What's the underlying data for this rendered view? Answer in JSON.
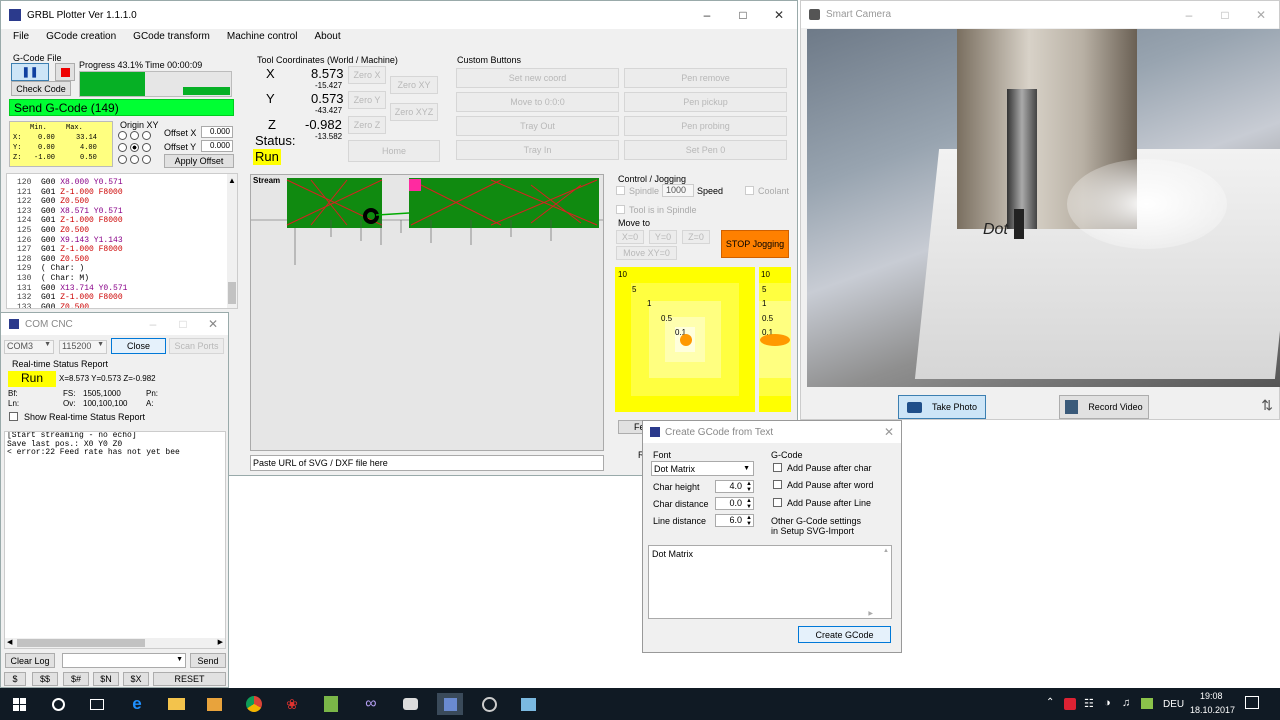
{
  "main_window": {
    "title": "GRBL Plotter Ver 1.1.1.0",
    "menu": [
      "File",
      "GCode creation",
      "GCode transform",
      "Machine control",
      "About"
    ],
    "gcode_file_label": "G-Code File",
    "progress_label": "Progress 43.1%",
    "time_label": "Time 00:00:09",
    "check_code": "Check Code",
    "send_gcode": "Send G-Code (149)",
    "minmax": {
      "min": "Min.",
      "max": "Max.",
      "x": "X:",
      "y": "Y:",
      "z": "Z:",
      "xmin": "0.00",
      "xmax": "33.14",
      "ymin": "0.00",
      "ymax": "4.00",
      "zmin": "-1.00",
      "zmax": "0.50"
    },
    "origin_label": "Origin XY",
    "offset_x_label": "Offset X",
    "offset_y_label": "Offset Y",
    "offset_x": "0.000",
    "offset_y": "0.000",
    "apply_offset": "Apply Offset",
    "tool_coords_label": "Tool Coordinates (World / Machine)",
    "coords": [
      {
        "axis": "X",
        "world": "8.573",
        "machine": "-15.427",
        "zero": "Zero X"
      },
      {
        "axis": "Y",
        "world": "0.573",
        "machine": "-43.427",
        "zero": "Zero Y"
      },
      {
        "axis": "Z",
        "world": "-0.982",
        "machine": "-13.582",
        "zero": "Zero Z"
      }
    ],
    "zero_xy": "Zero XY",
    "zero_xyz": "Zero XYZ",
    "home": "Home",
    "status_label": "Status:",
    "status_value": "Run",
    "custom_buttons_label": "Custom Buttons",
    "custom_buttons": [
      "Set new coord",
      "Pen remove",
      "Move to 0:0:0",
      "Pen pickup",
      "Tray Out",
      "Pen probing",
      "Tray In",
      "Set Pen 0"
    ],
    "gcode_lines": [
      {
        "n": "120",
        "parts": [
          [
            "a",
            "G00 "
          ],
          [
            "b",
            "X8.000 Y0.571"
          ]
        ]
      },
      {
        "n": "121",
        "parts": [
          [
            "a",
            "G01 "
          ],
          [
            "c",
            "Z-1.000 F8000"
          ]
        ]
      },
      {
        "n": "122",
        "parts": [
          [
            "a",
            "G00 "
          ],
          [
            "c",
            "Z0.500"
          ]
        ]
      },
      {
        "n": "123",
        "parts": [
          [
            "a",
            "G00 "
          ],
          [
            "b",
            "X8.571 Y0.571"
          ]
        ]
      },
      {
        "n": "124",
        "parts": [
          [
            "a",
            "G01 "
          ],
          [
            "c",
            "Z-1.000 F8000"
          ]
        ]
      },
      {
        "n": "125",
        "parts": [
          [
            "a",
            "G00 "
          ],
          [
            "c",
            "Z0.500"
          ]
        ]
      },
      {
        "n": "126",
        "parts": [
          [
            "a",
            "G00 "
          ],
          [
            "b",
            "X9.143 Y1.143"
          ]
        ]
      },
      {
        "n": "127",
        "parts": [
          [
            "a",
            "G01 "
          ],
          [
            "c",
            "Z-1.000 F8000"
          ]
        ]
      },
      {
        "n": "128",
        "parts": [
          [
            "a",
            "G00 "
          ],
          [
            "c",
            "Z0.500"
          ]
        ]
      },
      {
        "n": "129",
        "parts": [
          [
            "a",
            "( Char: )"
          ]
        ]
      },
      {
        "n": "130",
        "parts": [
          [
            "a",
            "( Char: M)"
          ]
        ]
      },
      {
        "n": "131",
        "parts": [
          [
            "a",
            "G00 "
          ],
          [
            "b",
            "X13.714 Y0.571"
          ]
        ]
      },
      {
        "n": "132",
        "parts": [
          [
            "a",
            "G01 "
          ],
          [
            "c",
            "Z-1.000 F8000"
          ]
        ]
      },
      {
        "n": "133",
        "parts": [
          [
            "a",
            "G00 "
          ],
          [
            "c",
            "Z0.500"
          ]
        ]
      }
    ],
    "stream_label": "Stream",
    "paste_url": "Paste URL of SVG / DXF file here",
    "control_label": "Control / Jogging",
    "spindle": "Spindle",
    "spindle_speed": "1000",
    "speed": "Speed",
    "coolant": "Coolant",
    "tool_in_spindle": "Tool is in Spindle",
    "move_to": "Move to",
    "x0": "X=0",
    "y0": "Y=0",
    "z0": "Z=0",
    "move_xy0": "Move XY=0",
    "stop_jogging": "STOP Jogging",
    "jog_left": [
      "10",
      "5",
      "1",
      "0.5",
      "0.1"
    ],
    "jog_right": [
      "10",
      "5",
      "1",
      "0.5",
      "0.1"
    ]
  },
  "com_window": {
    "title": "COM CNC",
    "port": "COM3",
    "baud": "115200",
    "close": "Close",
    "scan": "Scan Ports",
    "rt_label": "Real-time Status Report",
    "run": "Run",
    "pos": "X=8.573 Y=0.573 Z=-0.982",
    "bf": "Bf:",
    "fs": "FS:",
    "fs_val": "1505,1000",
    "pn": "Pn:",
    "ln": "Ln:",
    "ov": "Ov:",
    "ov_val": "100,100,100",
    "a": "A:",
    "show_rt": "Show Real-time Status Report",
    "log": [
      "[Start streaming - no echo]",
      "Save last pos.: X0 Y0 Z0",
      "< error:22    Feed rate has not yet bee"
    ],
    "clear_log": "Clear Log",
    "send": "Send",
    "cmds": [
      "$",
      "$$",
      "$#",
      "$N",
      "$X"
    ],
    "reset": "RESET"
  },
  "camera_window": {
    "title": "Smart Camera",
    "overlay_text": "Dot",
    "take_photo": "Take Photo",
    "record_video": "Record Video"
  },
  "text_dialog": {
    "title": "Create GCode from Text",
    "font_label": "Font",
    "font_value": "Dot Matrix",
    "char_height_label": "Char height",
    "char_height": "4.0",
    "char_distance_label": "Char distance",
    "char_distance": "0.0",
    "line_distance_label": "Line distance",
    "line_distance": "6.0",
    "gcode_label": "G-Code",
    "pause_char": "Add Pause after char",
    "pause_word": "Add Pause after word",
    "pause_line": "Add Pause after Line",
    "other_settings": "Other G-Code settings",
    "setup_import": "in Setup SVG-Import",
    "text": "Dot Matrix",
    "create": "Create GCode",
    "hidden_fe": "Fe",
    "hidden_r": "R"
  },
  "taskbar": {
    "lang": "DEU",
    "time": "19:08",
    "date": "18.10.2017"
  },
  "colors": {
    "run_yellow": "#ffff00",
    "send_green": "#00ff33",
    "stop_orange": "#ff8000"
  }
}
